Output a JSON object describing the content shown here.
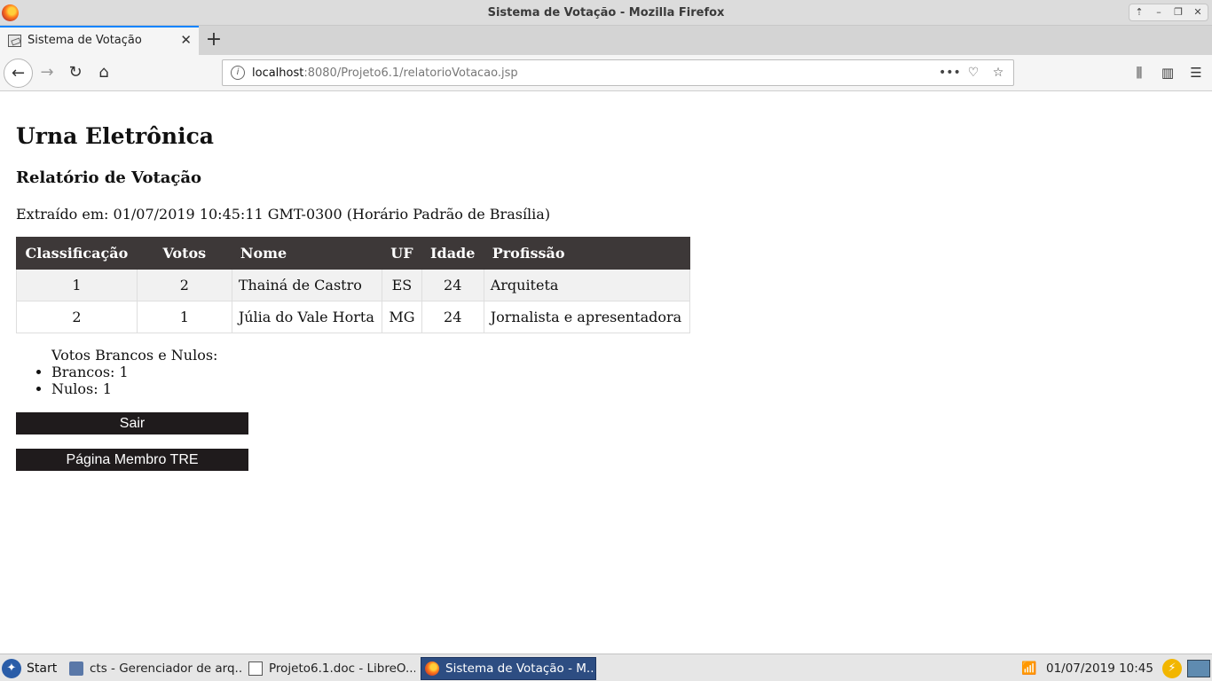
{
  "window": {
    "title": "Sistema de Votação - Mozilla Firefox"
  },
  "tab": {
    "label": "Sistema de Votação"
  },
  "url": {
    "host": "localhost",
    "rest": ":8080/Projeto6.1/relatorioVotacao.jsp"
  },
  "page": {
    "heading": "Urna Eletrônica",
    "subheading": "Relatório de Votação",
    "extracted": "Extraído em: 01/07/2019 10:45:11 GMT-0300 (Horário Padrão de Brasília)",
    "table": {
      "headers": [
        "Classificação",
        "Votos",
        "Nome",
        "UF",
        "Idade",
        "Profissão"
      ],
      "rows": [
        [
          "1",
          "2",
          "Thainá de Castro",
          "ES",
          "24",
          "Arquiteta"
        ],
        [
          "2",
          "1",
          "Júlia do Vale Horta",
          "MG",
          "24",
          "Jornalista e apresentadora"
        ]
      ]
    },
    "summary": {
      "caption": "Votos Brancos e Nulos:",
      "items": [
        "Brancos: 1",
        "Nulos: 1"
      ]
    },
    "buttons": {
      "exit": "Sair",
      "tre": "Página Membro TRE"
    }
  },
  "taskbar": {
    "start": "Start",
    "tasks": [
      "cts - Gerenciador de arq...",
      "Projeto6.1.doc - LibreO...",
      "Sistema de Votação - M..."
    ],
    "clock": "01/07/2019 10:45"
  },
  "colors": {
    "tab_accent": "#0a84ff",
    "table_header": "#3d3838",
    "button_bg": "#1f1b1c",
    "active_task": "#2d4d82"
  },
  "icons": [
    "firefox-icon",
    "back-icon",
    "forward-icon",
    "reload-icon",
    "home-icon",
    "info-icon",
    "more-icon",
    "pocket-icon",
    "bookmark-star-icon",
    "library-icon",
    "sidebar-icon",
    "menu-icon",
    "wifi-icon",
    "power-icon"
  ]
}
